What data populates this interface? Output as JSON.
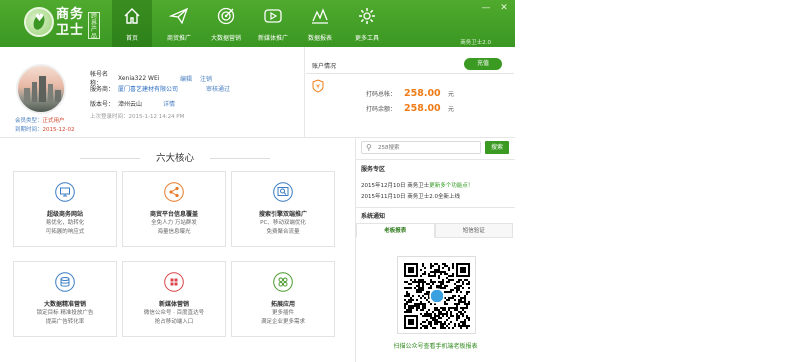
{
  "app": {
    "logo_title": "商务卫士",
    "logo_tag": "跨界产品",
    "version": "商务卫士2.0",
    "brand_color": "#3a9a22",
    "accent_color": "#f07c17"
  },
  "nav": [
    {
      "label": "首页",
      "icon": "home-icon",
      "active": true
    },
    {
      "label": "商贸推广",
      "icon": "paper-plane-icon"
    },
    {
      "label": "大数据营销",
      "icon": "target-icon"
    },
    {
      "label": "新媒体推广",
      "icon": "play-icon"
    },
    {
      "label": "数据报表",
      "icon": "chart-icon"
    },
    {
      "label": "更多工具",
      "icon": "gear-icon"
    }
  ],
  "profile": {
    "account_label": "帐号名称：",
    "account_name": "Xenia322 WEi",
    "edit": "编辑",
    "logout": "注销",
    "service_label": "服务商：",
    "service_name": "厦门喜艺建材有限公司",
    "review": "审核通过",
    "version_label": "版本号：",
    "version_name": "漳州云山",
    "details": "详情",
    "last_login": "上次登录时间：2015-1-12 14:24 PM",
    "member_type_label": "会员类型：",
    "member_type": "正式用户",
    "expire_label": "到期时间：",
    "expire_date": "2015-12-02"
  },
  "account": {
    "title": "账户情况",
    "recharge": "充值",
    "total_label": "打码总帐：",
    "total_amount": "258.00",
    "balance_label": "打码余额：",
    "balance_amount": "258.00",
    "unit": "元"
  },
  "core": {
    "title": "六大核心",
    "cards": [
      {
        "title": "超级商务网站",
        "desc1": "易优化，助转化",
        "desc2": "可拓展的响应式",
        "color": "#3a7cc4",
        "icon": "monitor-icon"
      },
      {
        "title": "商贸平台信息覆盖",
        "desc1": "全免人力 万站群发",
        "desc2": "海量信息曝光",
        "color": "#e87b2a",
        "icon": "share-icon"
      },
      {
        "title": "搜索引擎双端推广",
        "desc1": "PC、移动双端优化",
        "desc2": "免费聚合流量",
        "color": "#3a7cc4",
        "icon": "search-screen-icon"
      },
      {
        "title": "大数据精准营销",
        "desc1": "锁定目标 精准投放广告",
        "desc2": "提高广告转化率",
        "color": "#3a7cc4",
        "icon": "data-icon"
      },
      {
        "title": "新媒体营销",
        "desc1": "微信公众号 · 百度直达号",
        "desc2": "抢占移动端入口",
        "color": "#d9434a",
        "icon": "cube-icon"
      },
      {
        "title": "拓展应用",
        "desc1": "更多插件",
        "desc2": "满足企业更多需求",
        "color": "#4a9a2e",
        "icon": "apps-icon"
      }
    ]
  },
  "right": {
    "search_placeholder": "258搜索",
    "search_button": "搜索",
    "service_title": "服务专区",
    "news": [
      {
        "date": "2015年12月10日",
        "pre": "商务卫士",
        "hl": "更新多个功能点！"
      },
      {
        "date": "2015年11月10日",
        "pre": "商务卫士2.0全新上线",
        "hl": ""
      }
    ],
    "notify_title": "系统通知",
    "tabs": [
      {
        "label": "老板报表",
        "active": true
      },
      {
        "label": "短信验证",
        "active": false
      }
    ],
    "qr_caption": "扫描公众号查看手机端老板报表"
  },
  "window": {
    "minimize": "—",
    "close": "✕"
  }
}
